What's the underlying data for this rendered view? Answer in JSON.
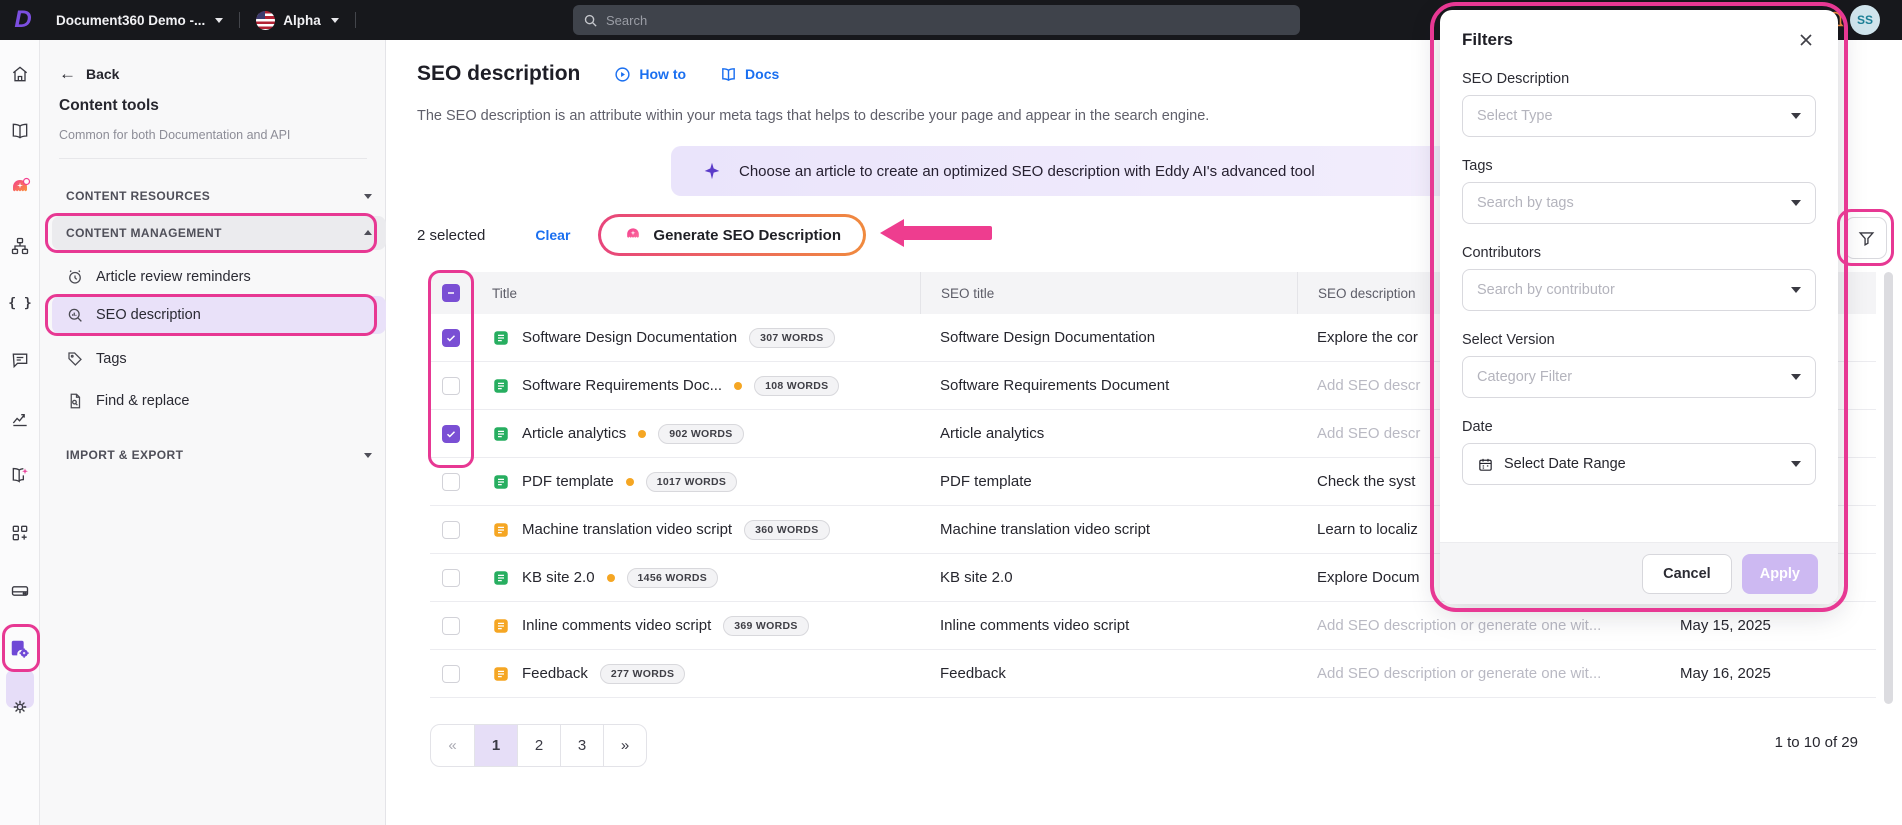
{
  "topbar": {
    "project_name": "Document360 Demo -...",
    "workspace": "Alpha",
    "search_placeholder": "Search",
    "avatar_initials": "SS"
  },
  "sidebar": {
    "back_label": "Back",
    "title": "Content tools",
    "subtitle": "Common for both Documentation and API",
    "section_resources": "CONTENT RESOURCES",
    "section_management": "CONTENT MANAGEMENT",
    "items": [
      {
        "label": "Article review reminders"
      },
      {
        "label": "SEO description"
      },
      {
        "label": "Tags"
      },
      {
        "label": "Find & replace"
      }
    ],
    "section_import": "IMPORT & EXPORT"
  },
  "main": {
    "title": "SEO description",
    "howto_label": "How to",
    "docs_label": "Docs",
    "description": "The SEO description is an attribute within your meta tags that helps to describe your page and appear in the search engine.",
    "banner_text": "Choose an article to create an optimized SEO description with Eddy AI's advanced tool",
    "selected_text": "2 selected",
    "clear_label": "Clear",
    "generate_label": "Generate SEO Description",
    "table": {
      "columns": {
        "title": "Title",
        "seo_title": "SEO title",
        "seo_description": "SEO description"
      },
      "rows": [
        {
          "title": "Software Design Documentation",
          "words": "307 WORDS",
          "seo_title": "Software Design Documentation",
          "seo_description": "Explore the cor",
          "date": "",
          "checked": true,
          "icon": "green",
          "dot": false,
          "desc_muted": false
        },
        {
          "title": "Software Requirements Doc...",
          "words": "108 WORDS",
          "seo_title": "Software Requirements Document",
          "seo_description": "Add SEO descr",
          "date": "",
          "checked": false,
          "icon": "green",
          "dot": true,
          "desc_muted": true
        },
        {
          "title": "Article analytics",
          "words": "902 WORDS",
          "seo_title": "Article analytics",
          "seo_description": "Add SEO descr",
          "date": "",
          "checked": true,
          "icon": "green",
          "dot": true,
          "desc_muted": true
        },
        {
          "title": "PDF template",
          "words": "1017 WORDS",
          "seo_title": "PDF template",
          "seo_description": "Check the syst",
          "date": "",
          "checked": false,
          "icon": "green",
          "dot": true,
          "desc_muted": false
        },
        {
          "title": "Machine translation video script",
          "words": "360 WORDS",
          "seo_title": "Machine translation video script",
          "seo_description": "Learn to localiz",
          "date": "",
          "checked": false,
          "icon": "orange",
          "dot": false,
          "desc_muted": false
        },
        {
          "title": "KB site 2.0",
          "words": "1456 WORDS",
          "seo_title": "KB site 2.0",
          "seo_description": "Explore Docum",
          "date": "",
          "checked": false,
          "icon": "green",
          "dot": true,
          "desc_muted": false
        },
        {
          "title": "Inline comments video script",
          "words": "369 WORDS",
          "seo_title": "Inline comments video script",
          "seo_description": "Add SEO description or generate one wit...",
          "date": "May 15, 2025",
          "checked": false,
          "icon": "orange",
          "dot": false,
          "desc_muted": true
        },
        {
          "title": "Feedback",
          "words": "277 WORDS",
          "seo_title": "Feedback",
          "seo_description": "Add SEO description or generate one wit...",
          "date": "May 16, 2025",
          "checked": false,
          "icon": "orange",
          "dot": false,
          "desc_muted": true
        }
      ]
    },
    "pagination": {
      "prev": "«",
      "pages": [
        "1",
        "2",
        "3"
      ],
      "current": "1",
      "next": "»",
      "range_text": "1 to 10 of 29"
    }
  },
  "filters": {
    "title": "Filters",
    "fields": [
      {
        "label": "SEO Description",
        "placeholder": "Select Type"
      },
      {
        "label": "Tags",
        "placeholder": "Search by tags"
      },
      {
        "label": "Contributors",
        "placeholder": "Search by contributor"
      },
      {
        "label": "Select Version",
        "placeholder": "Category Filter"
      },
      {
        "label": "Date",
        "placeholder": "Select Date Range"
      }
    ],
    "cancel_label": "Cancel",
    "apply_label": "Apply"
  },
  "colors": {
    "annotation_pink": "#e73893",
    "accent_purple": "#7a4fd4",
    "active_item_bg": "#e9e1f9",
    "link_blue": "#1a6ff0",
    "doc_green": "#27ae60",
    "doc_orange": "#f5a623",
    "apply_disabled_bg": "#cdb9f2"
  }
}
